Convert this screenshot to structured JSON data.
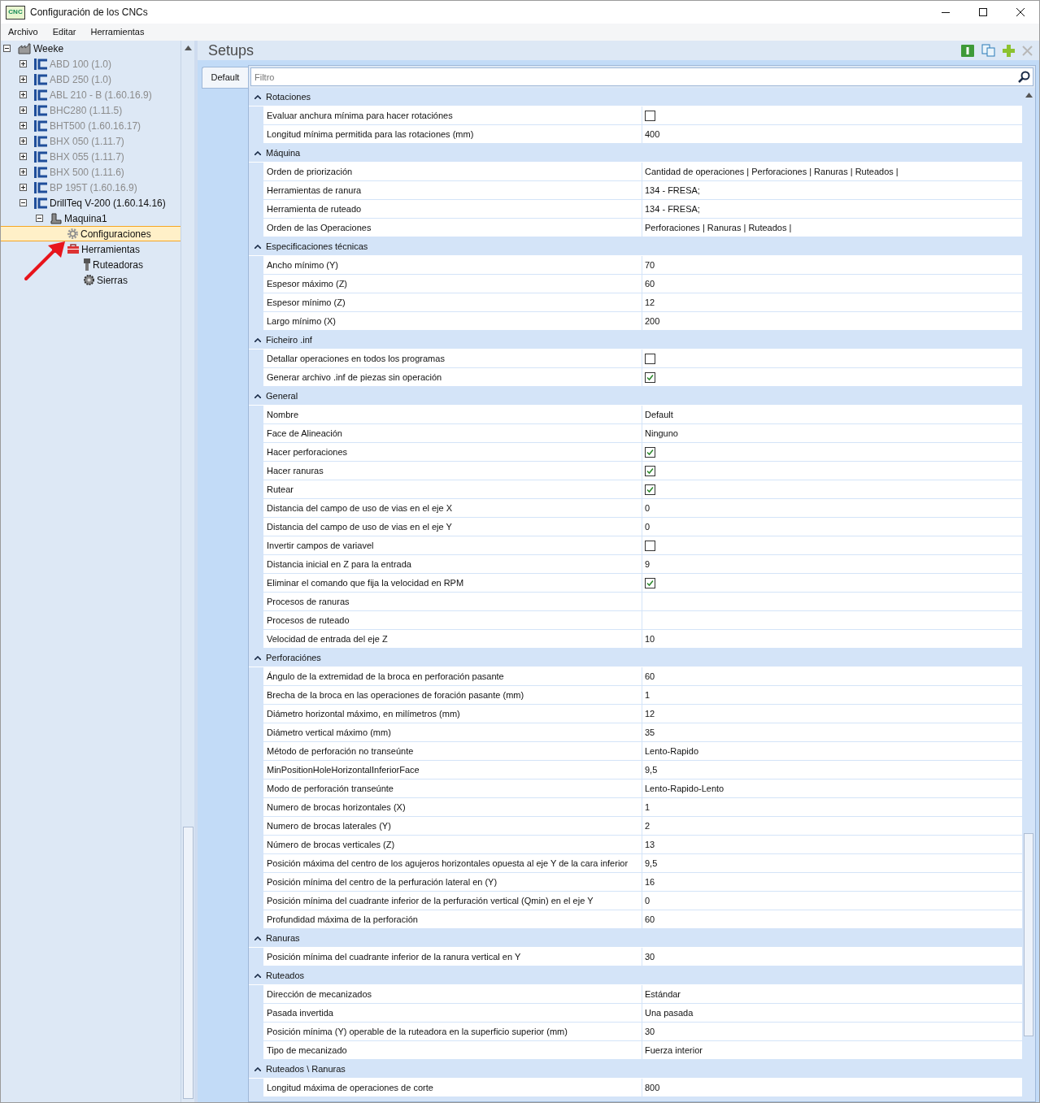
{
  "window": {
    "title": "Configuración de los CNCs",
    "app_icon": "CNC"
  },
  "menu": [
    "Archivo",
    "Editar",
    "Herramientas"
  ],
  "tree": [
    {
      "label": "Weeke",
      "kind": "factory",
      "expanded": true,
      "disabled": false,
      "selected": false,
      "children": [
        {
          "label": "ABD 100 (1.0)",
          "kind": "cnc",
          "expanded": false,
          "disabled": true,
          "selected": false
        },
        {
          "label": "ABD 250 (1.0)",
          "kind": "cnc",
          "expanded": false,
          "disabled": true,
          "selected": false
        },
        {
          "label": "ABL 210 - B (1.60.16.9)",
          "kind": "cnc",
          "expanded": false,
          "disabled": true,
          "selected": false
        },
        {
          "label": "BHC280 (1.11.5)",
          "kind": "cnc",
          "expanded": false,
          "disabled": true,
          "selected": false
        },
        {
          "label": "BHT500 (1.60.16.17)",
          "kind": "cnc",
          "expanded": false,
          "disabled": true,
          "selected": false
        },
        {
          "label": "BHX 050 (1.11.7)",
          "kind": "cnc",
          "expanded": false,
          "disabled": true,
          "selected": false
        },
        {
          "label": "BHX 055 (1.11.7)",
          "kind": "cnc",
          "expanded": false,
          "disabled": true,
          "selected": false
        },
        {
          "label": "BHX 500 (1.11.6)",
          "kind": "cnc",
          "expanded": false,
          "disabled": true,
          "selected": false
        },
        {
          "label": "BP 195T (1.60.16.9)",
          "kind": "cnc",
          "expanded": false,
          "disabled": true,
          "selected": false
        },
        {
          "label": "DrillTeq V-200 (1.60.14.16)",
          "kind": "cnc",
          "expanded": true,
          "disabled": false,
          "selected": false,
          "children": [
            {
              "label": "Maquina1",
              "kind": "machine",
              "expanded": true,
              "disabled": false,
              "selected": false,
              "children": [
                {
                  "label": "Configuraciones",
                  "kind": "gear",
                  "disabled": false,
                  "selected": true
                },
                {
                  "label": "Herramientas",
                  "kind": "toolbox",
                  "expanded": true,
                  "disabled": false,
                  "selected": false,
                  "children": [
                    {
                      "label": "Ruteadoras",
                      "kind": "router",
                      "disabled": false,
                      "selected": false
                    },
                    {
                      "label": "Sierras",
                      "kind": "saw",
                      "disabled": false,
                      "selected": false
                    }
                  ]
                }
              ]
            }
          ]
        }
      ]
    }
  ],
  "panel": {
    "title": "Setups",
    "tabs": [
      {
        "label": "Default",
        "selected": true
      }
    ],
    "filter": {
      "placeholder": "Filtro"
    }
  },
  "sections": [
    {
      "title": "Rotaciones",
      "expanded": true,
      "rows": [
        {
          "label": "Evaluar anchura mínima para hacer rotaciónes",
          "kind": "checkbox",
          "checked": false
        },
        {
          "label": "Longitud mínima permitida para las rotaciones (mm)",
          "kind": "text",
          "value": "400"
        }
      ]
    },
    {
      "title": "Máquina",
      "expanded": true,
      "rows": [
        {
          "label": "Orden de priorización",
          "kind": "text",
          "value": "Cantidad de operaciones | Perforaciones | Ranuras | Ruteados |"
        },
        {
          "label": "Herramientas de ranura",
          "kind": "text",
          "value": "134 - FRESA;"
        },
        {
          "label": "Herramienta de ruteado",
          "kind": "text",
          "value": "134 - FRESA;"
        },
        {
          "label": "Orden de las Operaciones",
          "kind": "text",
          "value": "Perforaciones | Ranuras | Ruteados |"
        }
      ]
    },
    {
      "title": "Especificaciones técnicas",
      "expanded": true,
      "rows": [
        {
          "label": "Ancho mínimo (Y)",
          "kind": "text",
          "value": "70"
        },
        {
          "label": "Espesor máximo (Z)",
          "kind": "text",
          "value": "60"
        },
        {
          "label": "Espesor mínimo (Z)",
          "kind": "text",
          "value": "12"
        },
        {
          "label": "Largo mínimo (X)",
          "kind": "text",
          "value": "200"
        }
      ]
    },
    {
      "title": "Ficheiro .inf",
      "expanded": true,
      "rows": [
        {
          "label": "Detallar operaciones en todos los programas",
          "kind": "checkbox",
          "checked": false
        },
        {
          "label": "Generar archivo .inf de piezas sin operación",
          "kind": "checkbox",
          "checked": true
        }
      ]
    },
    {
      "title": "General",
      "expanded": true,
      "rows": [
        {
          "label": "Nombre",
          "kind": "text",
          "value": "Default"
        },
        {
          "label": "Face de Alineación",
          "kind": "text",
          "value": "Ninguno"
        },
        {
          "label": "Hacer perforaciones",
          "kind": "checkbox",
          "checked": true
        },
        {
          "label": "Hacer ranuras",
          "kind": "checkbox",
          "checked": true
        },
        {
          "label": "Rutear",
          "kind": "checkbox",
          "checked": true
        },
        {
          "label": "Distancia del campo de uso de vias en el eje X",
          "kind": "text",
          "value": "0"
        },
        {
          "label": "Distancia del campo de uso de vias en el eje Y",
          "kind": "text",
          "value": "0"
        },
        {
          "label": "Invertir campos de variavel",
          "kind": "checkbox",
          "checked": false
        },
        {
          "label": "Distancia inicial en Z para la entrada",
          "kind": "text",
          "value": "9"
        },
        {
          "label": "Eliminar el comando que fija la velocidad en RPM",
          "kind": "checkbox",
          "checked": true
        },
        {
          "label": "Procesos de ranuras",
          "kind": "text"
        },
        {
          "label": "Procesos de ruteado",
          "kind": "text"
        },
        {
          "label": "Velocidad de entrada del eje Z",
          "kind": "text",
          "value": "10"
        }
      ]
    },
    {
      "title": "Perforaciónes",
      "expanded": true,
      "rows": [
        {
          "label": "Ángulo de la extremidad de la broca en perforación pasante",
          "kind": "text",
          "value": "60"
        },
        {
          "label": "Brecha de la broca en las operaciones de foración pasante (mm)",
          "kind": "text",
          "value": "1"
        },
        {
          "label": "Diámetro horizontal máximo, en milímetros (mm)",
          "kind": "text",
          "value": "12"
        },
        {
          "label": "Diámetro vertical máximo (mm)",
          "kind": "text",
          "value": "35"
        },
        {
          "label": "Método de perforación no transeúnte",
          "kind": "text",
          "value": "Lento-Rapido"
        },
        {
          "label": "MinPositionHoleHorizontalInferiorFace",
          "kind": "text",
          "value": "9,5"
        },
        {
          "label": "Modo de perforación transeúnte",
          "kind": "text",
          "value": "Lento-Rapido-Lento"
        },
        {
          "label": "Numero de brocas horizontales (X)",
          "kind": "text",
          "value": "1"
        },
        {
          "label": "Numero de brocas laterales (Y)",
          "kind": "text",
          "value": "2"
        },
        {
          "label": "Número de brocas verticales (Z)",
          "kind": "text",
          "value": "13"
        },
        {
          "label": "Posición máxima del centro de los agujeros horizontales opuesta al eje Y de la cara inferior",
          "kind": "text",
          "value": "9,5"
        },
        {
          "label": "Posición mínima del centro de la perfuración lateral en (Y)",
          "kind": "text",
          "value": "16"
        },
        {
          "label": "Posición mínima del cuadrante inferior de la perfuración vertical (Qmin) en el eje Y",
          "kind": "text",
          "value": "0"
        },
        {
          "label": "Profundidad máxima de la perforación",
          "kind": "text",
          "value": "60"
        }
      ]
    },
    {
      "title": "Ranuras",
      "expanded": true,
      "rows": [
        {
          "label": "Posición mínima del cuadrante inferior de la ranura vertical en Y",
          "kind": "text",
          "value": "30"
        }
      ]
    },
    {
      "title": "Ruteados",
      "expanded": true,
      "rows": [
        {
          "label": "Dirección de mecanizados",
          "kind": "text",
          "value": "Estándar"
        },
        {
          "label": "Pasada invertida",
          "kind": "text",
          "value": "Una pasada"
        },
        {
          "label": "Posición mínima (Y) operable de la ruteadora en la superficio superior (mm)",
          "kind": "text",
          "value": "30"
        },
        {
          "label": "Tipo de mecanizado",
          "kind": "text",
          "value": "Fuerza interior"
        }
      ]
    },
    {
      "title": "Ruteados \\ Ranuras",
      "expanded": true,
      "rows": [
        {
          "label": "Longitud máxima de operaciones de corte",
          "kind": "text",
          "value": "800"
        }
      ]
    }
  ]
}
